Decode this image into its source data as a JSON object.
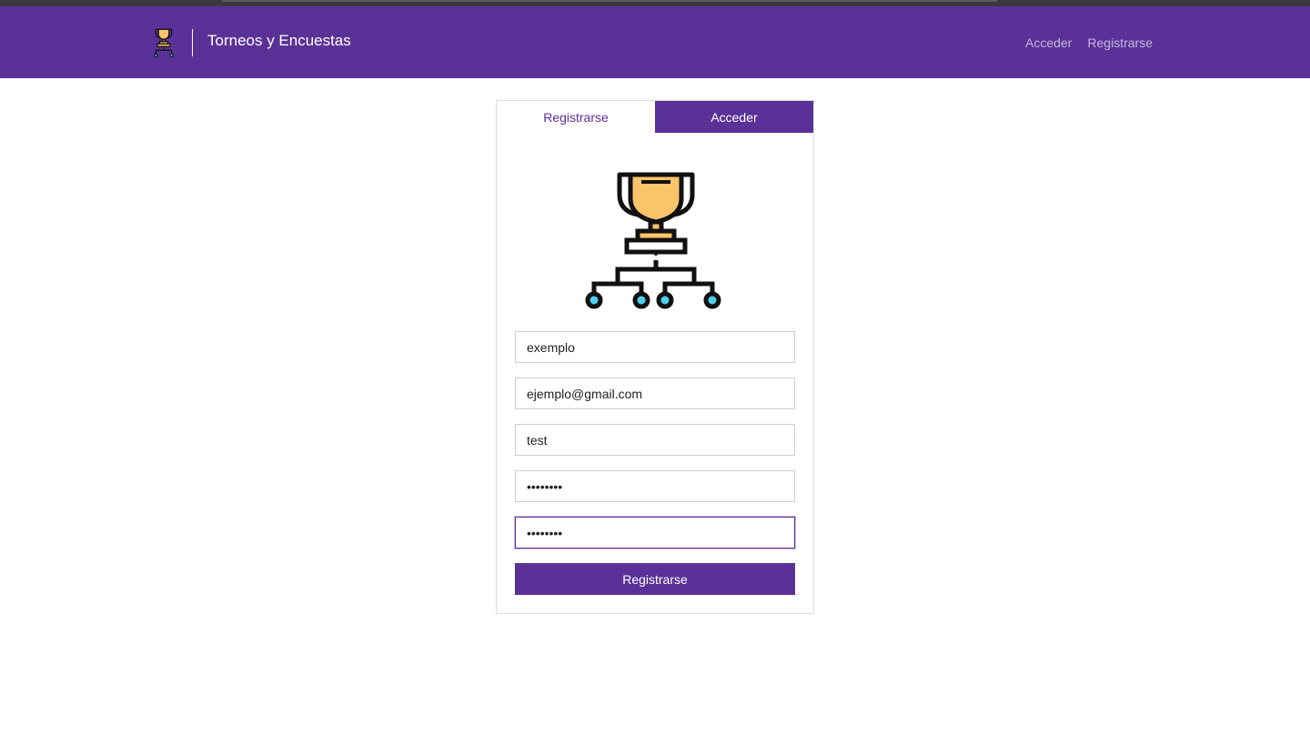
{
  "header": {
    "brand_title": "Torneos y Encuestas",
    "brand_icon": "trophy-bracket-icon",
    "nav": {
      "login_label": "Acceder",
      "register_label": "Registrarse"
    }
  },
  "card": {
    "tabs": [
      {
        "label": "Registrarse",
        "active": true
      },
      {
        "label": "Acceder",
        "active": false
      }
    ],
    "logo_icon": "trophy-bracket-icon",
    "fields": {
      "name_value": "exemplo",
      "email_value": "ejemplo@gmail.com",
      "username_value": "test",
      "password_value": "••••••••",
      "confirm_password_value": "••••••••"
    },
    "submit_label": "Registrarse"
  },
  "colors": {
    "brand": "#5a3196",
    "trophy": "#fcc46a",
    "node": "#4fd1ec"
  }
}
